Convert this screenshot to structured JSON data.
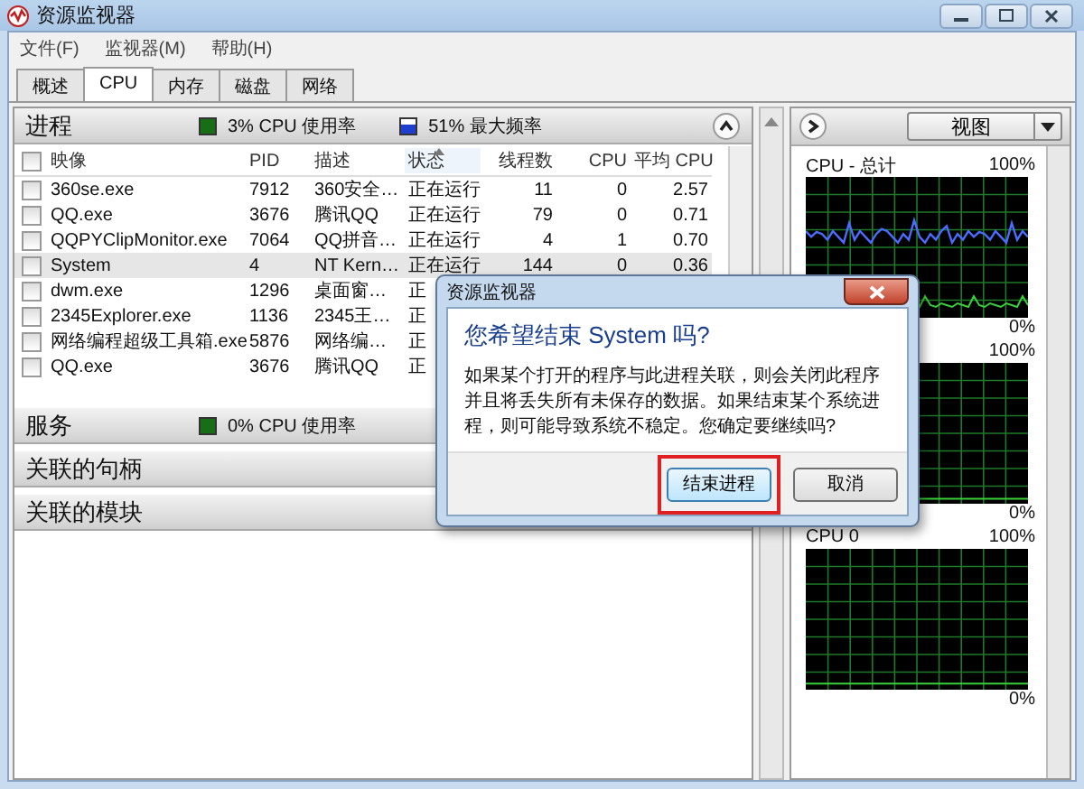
{
  "window": {
    "title": "资源监视器"
  },
  "menu": [
    "文件(F)",
    "监视器(M)",
    "帮助(H)"
  ],
  "tabs": [
    {
      "label": "概述",
      "selected": false
    },
    {
      "label": "CPU",
      "selected": true
    },
    {
      "label": "内存",
      "selected": false
    },
    {
      "label": "磁盘",
      "selected": false
    },
    {
      "label": "网络",
      "selected": false
    }
  ],
  "processes": {
    "title": "进程",
    "cpu_usage": "3% CPU 使用率",
    "max_frequency": "51% 最大频率",
    "expanded": true,
    "select_all_checked": false,
    "columns": [
      {
        "label": "映像",
        "sorted": false
      },
      {
        "label": "PID",
        "sorted": false
      },
      {
        "label": "描述",
        "sorted": false
      },
      {
        "label": "状态",
        "sorted": true
      },
      {
        "label": "线程数",
        "sorted": false
      },
      {
        "label": "CPU",
        "sorted": false
      },
      {
        "label": "平均 CPU",
        "sorted": false
      }
    ],
    "rows": [
      {
        "image": "360se.exe",
        "pid": "7912",
        "description": "360安全…",
        "status": "正在运行",
        "threads": "11",
        "cpu": "0",
        "avg_cpu": "2.57",
        "checked": false,
        "selected": false
      },
      {
        "image": "QQ.exe",
        "pid": "3676",
        "description": "腾讯QQ",
        "status": "正在运行",
        "threads": "79",
        "cpu": "0",
        "avg_cpu": "0.71",
        "checked": false,
        "selected": false
      },
      {
        "image": "QQPYClipMonitor.exe",
        "pid": "7064",
        "description": "QQ拼音…",
        "status": "正在运行",
        "threads": "4",
        "cpu": "1",
        "avg_cpu": "0.70",
        "checked": false,
        "selected": false
      },
      {
        "image": "System",
        "pid": "4",
        "description": "NT Kern…",
        "status": "正在运行",
        "threads": "144",
        "cpu": "0",
        "avg_cpu": "0.36",
        "checked": false,
        "selected": true
      },
      {
        "image": "dwm.exe",
        "pid": "1296",
        "description": "桌面窗…",
        "status": "正",
        "checked": false,
        "selected": false
      },
      {
        "image": "2345Explorer.exe",
        "pid": "1136",
        "description": "2345王…",
        "status": "正",
        "checked": false,
        "selected": false
      },
      {
        "image": "网络编程超级工具箱.exe",
        "pid": "5876",
        "description": "网络编…",
        "status": "正",
        "checked": false,
        "selected": false
      },
      {
        "image": "QQ.exe",
        "pid": "3676",
        "description": "腾讯QQ",
        "status": "正",
        "checked": false,
        "selected": false
      }
    ]
  },
  "sections": [
    {
      "title": "服务",
      "cpu_usage": "0% CPU 使用率"
    },
    {
      "title": "关联的句柄"
    },
    {
      "title": "关联的模块"
    }
  ],
  "monitor": {
    "view_button": "视图",
    "graphs": [
      {
        "title": "CPU - 总计",
        "max": "100%",
        "min": "0%",
        "kind": "busy"
      },
      {
        "max": "100%",
        "min": "0%",
        "kind": "idle"
      },
      {
        "title": "CPU 0",
        "max": "100%",
        "min": "0%",
        "kind": "idle"
      }
    ]
  },
  "dialog": {
    "title": "资源监视器",
    "heading": "您希望结束 System 吗?",
    "message": "如果某个打开的程序与此进程关联，则会关闭此程序并且将丢失所有未保存的数据。如果结束某个系统进程，则可能导致系统不稳定。您确定要继续吗?",
    "buttons": [
      {
        "label": "结束进程",
        "default": true,
        "highlighted": true
      },
      {
        "label": "取消",
        "default": false,
        "highlighted": false
      }
    ]
  }
}
